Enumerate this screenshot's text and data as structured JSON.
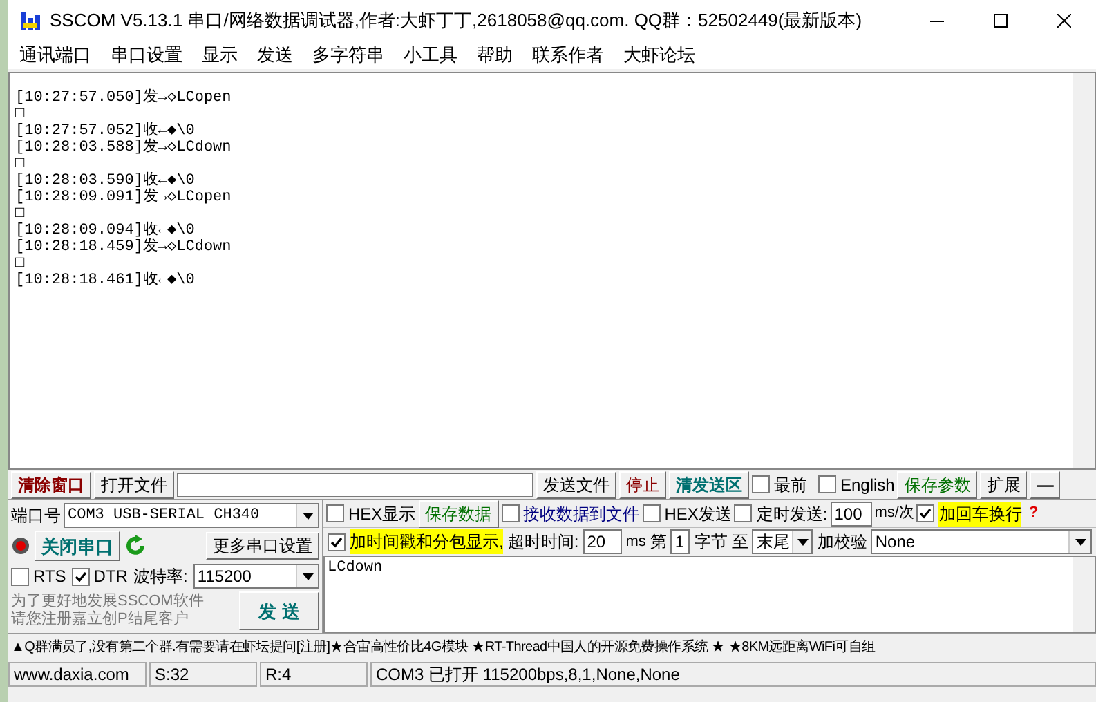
{
  "window": {
    "title": "SSCOM V5.13.1 串口/网络数据调试器,作者:大虾丁丁,2618058@qq.com. QQ群：52502449(最新版本)"
  },
  "menu": [
    "通讯端口",
    "串口设置",
    "显示",
    "发送",
    "多字符串",
    "小工具",
    "帮助",
    "联系作者",
    "大虾论坛"
  ],
  "receive_log": [
    "[10:27:57.050]发→◇LCopen",
    "□",
    "[10:27:57.052]收←◆\\0",
    "[10:28:03.588]发→◇LCdown",
    "□",
    "[10:28:03.590]收←◆\\0",
    "[10:28:09.091]发→◇LCopen",
    "□",
    "[10:28:09.094]收←◆\\0",
    "[10:28:18.459]发→◇LCdown",
    "□",
    "[10:28:18.461]收←◆\\0"
  ],
  "toolbar": {
    "clear_button": "清除窗口",
    "open_file_button": "打开文件",
    "send_file_button": "发送文件",
    "stop_button": "停止",
    "clear_send_button": "清发送区",
    "topmost": {
      "label": "最前",
      "checked": false
    },
    "english": {
      "label": "English",
      "checked": false
    },
    "save_params_button": "保存参数",
    "expand_button": "扩展",
    "collapse_button": "—"
  },
  "port": {
    "label": "端口号",
    "value": "COM3 USB-SERIAL CH340",
    "open": true,
    "toggle_button": "关闭串口",
    "more_settings_button": "更多串口设置",
    "rts": {
      "label": "RTS",
      "checked": false
    },
    "dtr": {
      "label": "DTR",
      "checked": true
    },
    "baud_label": "波特率:",
    "baud_value": "115200",
    "promo": [
      "为了更好地发展SSCOM软件",
      "请您注册嘉立创P结尾客户"
    ],
    "send_button": "发 送"
  },
  "options": {
    "hex_display": {
      "label": "HEX显示",
      "checked": false
    },
    "save_data_button": "保存数据",
    "receive_to_file": {
      "label": "接收数据到文件",
      "checked": false
    },
    "hex_send": {
      "label": "HEX发送",
      "checked": false
    },
    "timed_send": {
      "label": "定时发送:",
      "checked": false
    },
    "interval": "100",
    "interval_unit": "ms/次",
    "add_crlf": {
      "label": "加回车换行",
      "checked": true
    },
    "help": "?",
    "timestamp": {
      "label": "加时间戳和分包显示,",
      "checked": true
    },
    "timeout_label": "超时时间:",
    "timeout": "20",
    "timeout_unit": "ms",
    "byte_from_label": "第",
    "byte_from": "1",
    "byte_unit": "字节",
    "to_label": "至",
    "byte_to": "末尾",
    "checksum_label": "加校验",
    "checksum": "None"
  },
  "send_text": "LCdown",
  "ticker": "▲Q群满员了,没有第二个群.有需要请在虾坛提问[注册]★合宙高性价比4G模块 ★RT-Thread中国人的开源免费操作系统 ★ ★8KM远距离WiFi可自组",
  "status_bar": [
    "www.daxia.com",
    "S:32",
    "R:4",
    "COM3 已打开  115200bps,8,1,None,None"
  ]
}
